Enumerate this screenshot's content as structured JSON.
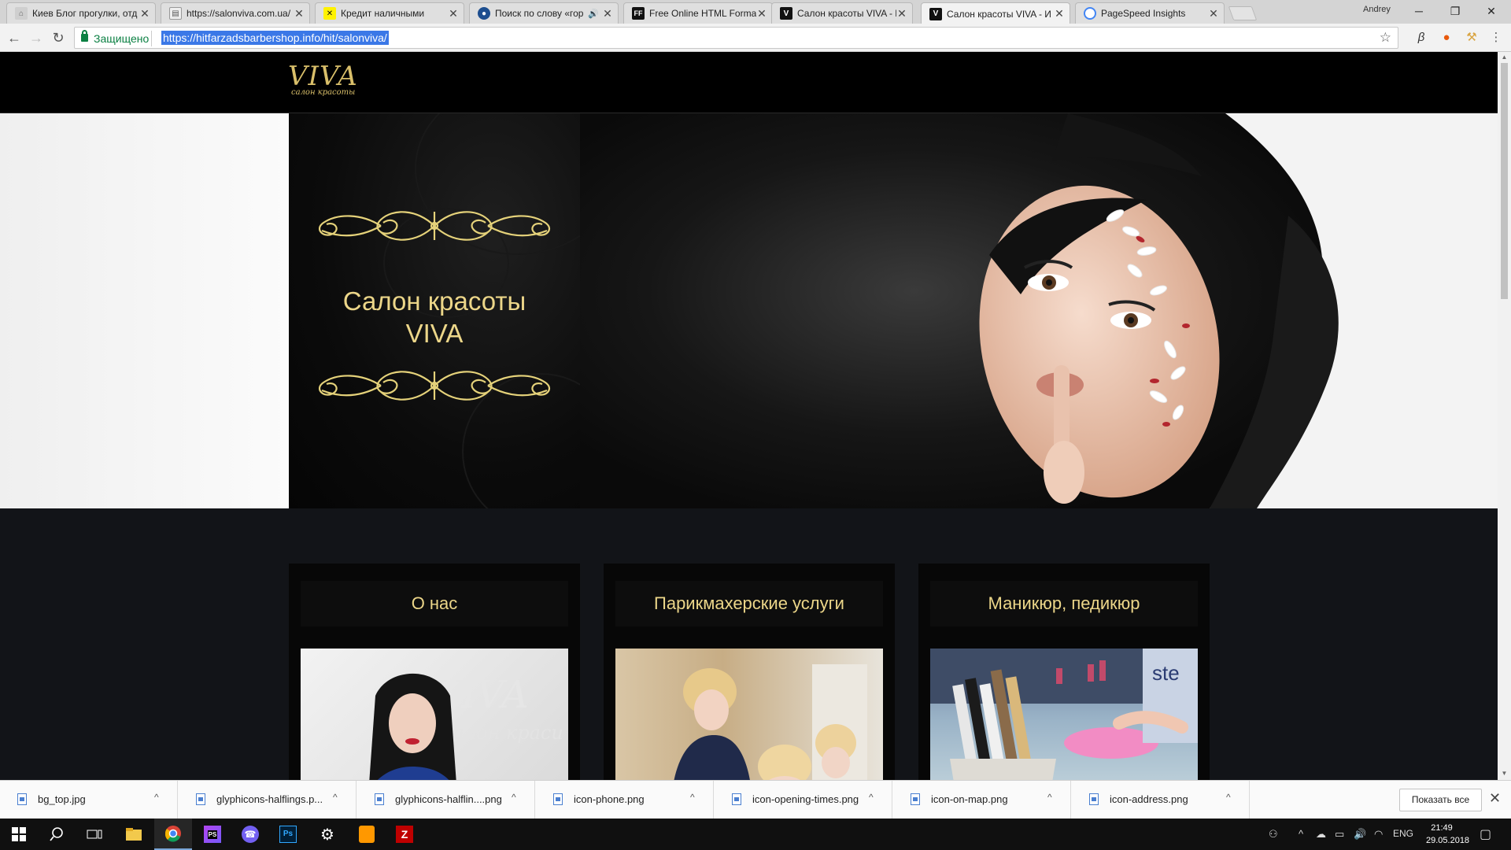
{
  "browser": {
    "tabs": [
      {
        "title": "Киев Блог прогулки, отд",
        "favicon": "hat-icon",
        "active": false,
        "audio": false
      },
      {
        "title": "https://salonviva.com.ua/",
        "favicon": "page-icon",
        "active": false,
        "audio": false
      },
      {
        "title": "Кредит наличными",
        "favicon": "raiffeisen-icon",
        "active": false,
        "audio": false
      },
      {
        "title": "Поиск по слову «гор",
        "favicon": "globe-icon",
        "active": false,
        "audio": true
      },
      {
        "title": "Free Online HTML Forma",
        "favicon": "ff-icon",
        "active": false,
        "audio": false
      },
      {
        "title": "Салон красоты VIVA - И",
        "favicon": "viva-icon",
        "active": false,
        "audio": false
      },
      {
        "title": "Салон красоты VIVA - И",
        "favicon": "viva-icon",
        "active": true,
        "audio": false
      },
      {
        "title": "PageSpeed Insights",
        "favicon": "pagespeed-icon",
        "active": false,
        "audio": false
      }
    ],
    "profile_name": "Andrey",
    "secure_label": "Защищено",
    "url": "https://hitfarzadsbarbershop.info/hit/salonviva/",
    "window_controls": {
      "minimize": "─",
      "restore": "❐",
      "close": "✕"
    }
  },
  "site": {
    "logo_main": "VIVA",
    "logo_sub": "салон красоты",
    "hero_title_line1": "Салон красоты",
    "hero_title_line2": "VIVA",
    "cards": [
      {
        "title": "О нас",
        "image": "salon-owner-photo"
      },
      {
        "title": "Парикмахерские услуги",
        "image": "hairdressing-photo"
      },
      {
        "title": "Маникюр, педикюр",
        "image": "manicure-tools-photo"
      }
    ]
  },
  "downloads": {
    "items": [
      {
        "name": "bg_top.jpg"
      },
      {
        "name": "glyphicons-halflings.p..."
      },
      {
        "name": "glyphicons-halflin....png"
      },
      {
        "name": "icon-phone.png"
      },
      {
        "name": "icon-opening-times.png"
      },
      {
        "name": "icon-on-map.png"
      },
      {
        "name": "icon-address.png"
      }
    ],
    "show_all_label": "Показать все"
  },
  "taskbar": {
    "language": "ENG",
    "time": "21:49",
    "date": "29.05.2018",
    "apps": [
      "start-icon",
      "search-icon",
      "task-view-icon",
      "file-explorer-icon",
      "chrome-icon",
      "phpstorm-icon",
      "viber-icon",
      "photoshop-icon",
      "settings-icon",
      "sublime-text-icon",
      "filezilla-icon"
    ]
  },
  "colors": {
    "gold": "#ecd689",
    "page_dark": "#121418",
    "selection": "#3b78e7",
    "secure_green": "#0b8043"
  }
}
